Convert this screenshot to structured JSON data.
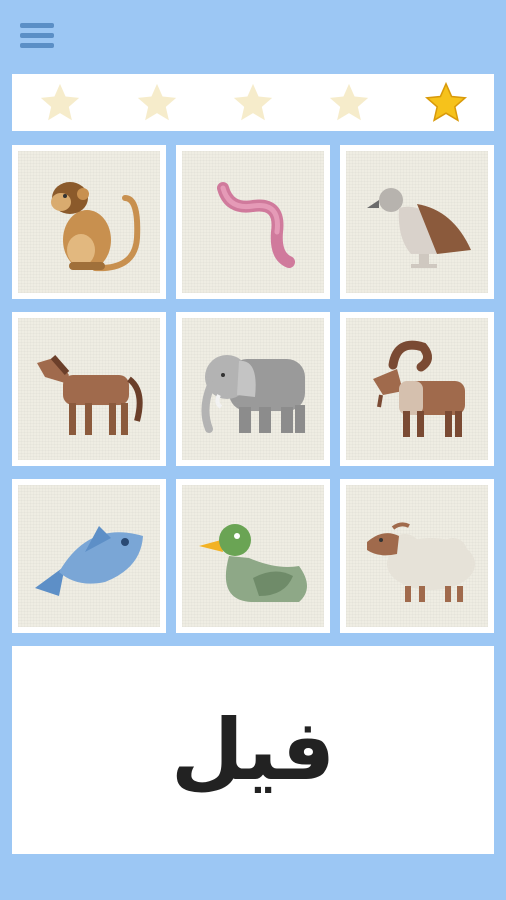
{
  "app": {
    "menu_icon": "hamburger-menu-icon"
  },
  "rating": {
    "total": 5,
    "filled": 1,
    "filled_index": 4,
    "color_filled": "#f6c21b",
    "color_empty": "#f6eccb"
  },
  "animals": [
    {
      "name": "monkey",
      "icon": "monkey-icon"
    },
    {
      "name": "worm",
      "icon": "worm-icon"
    },
    {
      "name": "vulture",
      "icon": "vulture-icon"
    },
    {
      "name": "horse",
      "icon": "horse-icon"
    },
    {
      "name": "elephant",
      "icon": "elephant-icon"
    },
    {
      "name": "goat",
      "icon": "goat-icon"
    },
    {
      "name": "fish",
      "icon": "fish-icon"
    },
    {
      "name": "duck",
      "icon": "duck-icon"
    },
    {
      "name": "sheep",
      "icon": "sheep-icon"
    }
  ],
  "prompt": {
    "word": "فيل"
  }
}
